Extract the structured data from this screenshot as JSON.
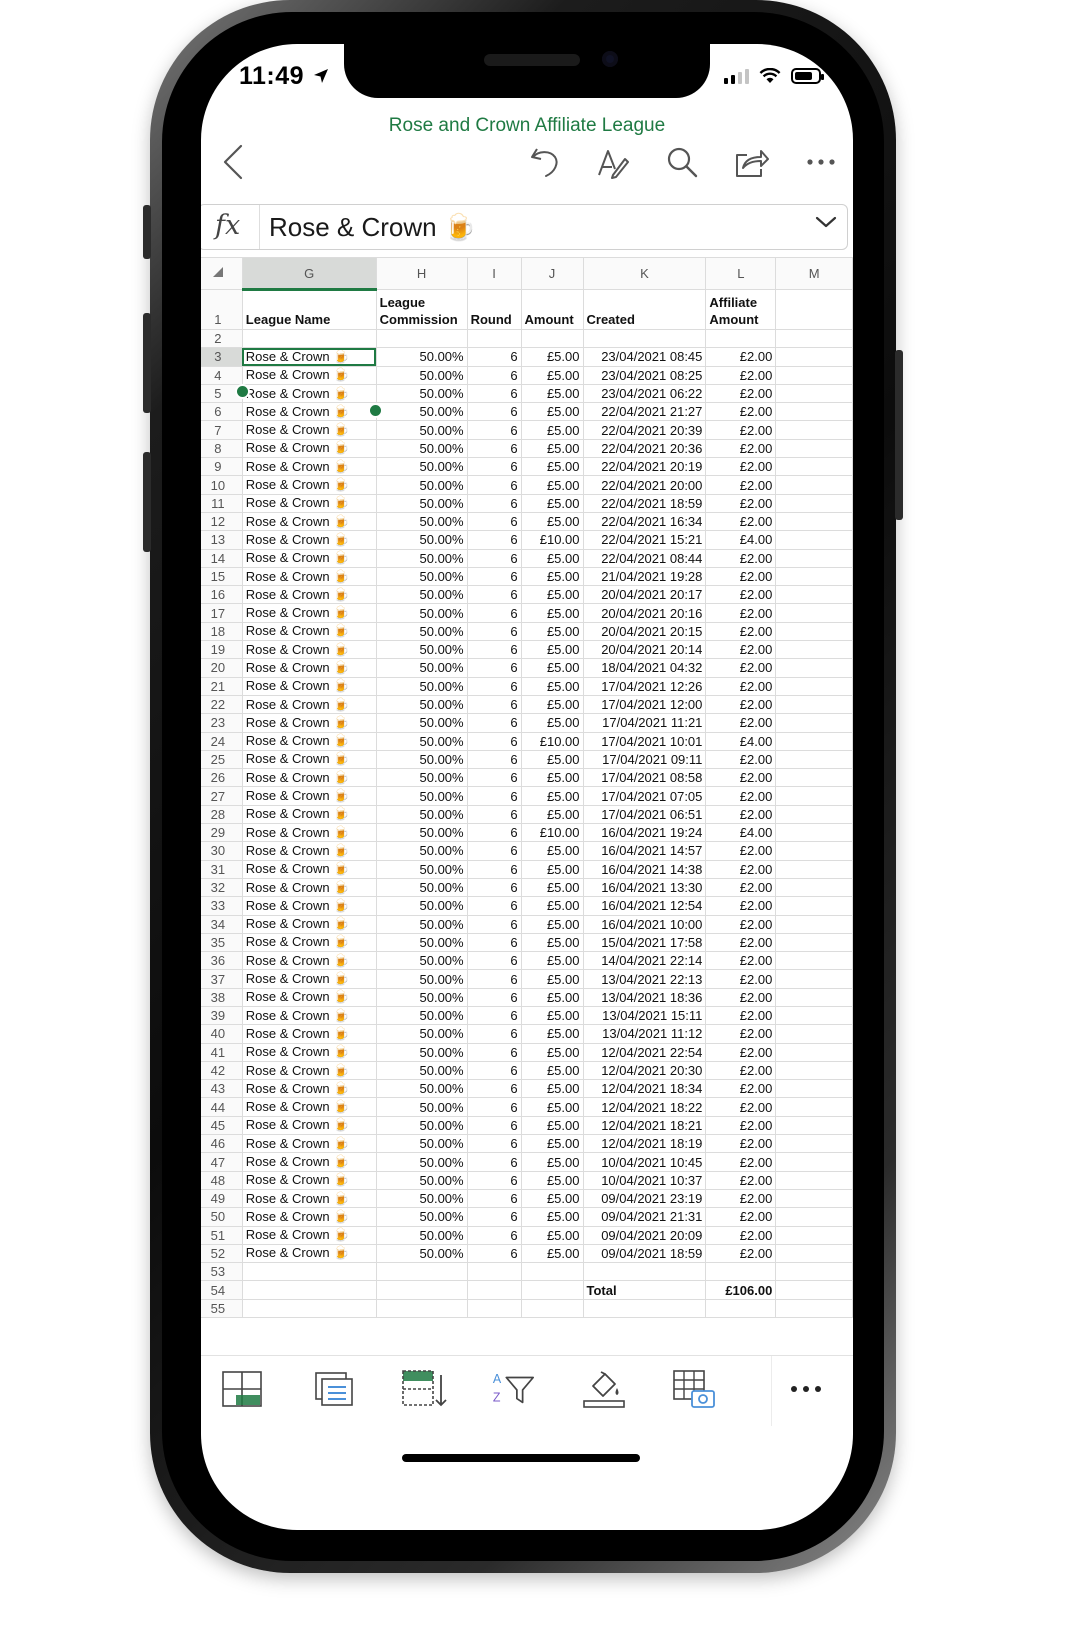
{
  "status": {
    "time": "11:49"
  },
  "document": {
    "title": "Rose and Crown Affiliate League"
  },
  "toolbar": {
    "icons": [
      "back-icon",
      "undo-icon",
      "pen-icon",
      "search-icon",
      "share-icon",
      "more-icon"
    ]
  },
  "formula_bar": {
    "label": "fx",
    "value": "Rose & Crown 🍺"
  },
  "columns": [
    "G",
    "H",
    "I",
    "J",
    "K",
    "L",
    "M"
  ],
  "selected_column": "G",
  "selected_row": 3,
  "header_row": {
    "row_number": "1",
    "cells": [
      "League Name",
      "League\nCommission",
      "Round",
      "Amount",
      "Created",
      "Affiliate\nAmount",
      ""
    ]
  },
  "rows": [
    {
      "n": "3",
      "name": "Rose & Crown 🍺",
      "comm": "50.00%",
      "round": "6",
      "amount": "£5.00",
      "created": "23/04/2021 08:45",
      "aff": "£2.00"
    },
    {
      "n": "4",
      "name": "Rose & Crown 🍺",
      "comm": "50.00%",
      "round": "6",
      "amount": "£5.00",
      "created": "23/04/2021 08:25",
      "aff": "£2.00"
    },
    {
      "n": "5",
      "name": "Rose & Crown 🍺",
      "comm": "50.00%",
      "round": "6",
      "amount": "£5.00",
      "created": "23/04/2021 06:22",
      "aff": "£2.00"
    },
    {
      "n": "6",
      "name": "Rose & Crown 🍺",
      "comm": "50.00%",
      "round": "6",
      "amount": "£5.00",
      "created": "22/04/2021 21:27",
      "aff": "£2.00"
    },
    {
      "n": "7",
      "name": "Rose & Crown 🍺",
      "comm": "50.00%",
      "round": "6",
      "amount": "£5.00",
      "created": "22/04/2021 20:39",
      "aff": "£2.00"
    },
    {
      "n": "8",
      "name": "Rose & Crown 🍺",
      "comm": "50.00%",
      "round": "6",
      "amount": "£5.00",
      "created": "22/04/2021 20:36",
      "aff": "£2.00"
    },
    {
      "n": "9",
      "name": "Rose & Crown 🍺",
      "comm": "50.00%",
      "round": "6",
      "amount": "£5.00",
      "created": "22/04/2021 20:19",
      "aff": "£2.00"
    },
    {
      "n": "10",
      "name": "Rose & Crown 🍺",
      "comm": "50.00%",
      "round": "6",
      "amount": "£5.00",
      "created": "22/04/2021 20:00",
      "aff": "£2.00"
    },
    {
      "n": "11",
      "name": "Rose & Crown 🍺",
      "comm": "50.00%",
      "round": "6",
      "amount": "£5.00",
      "created": "22/04/2021 18:59",
      "aff": "£2.00"
    },
    {
      "n": "12",
      "name": "Rose & Crown 🍺",
      "comm": "50.00%",
      "round": "6",
      "amount": "£5.00",
      "created": "22/04/2021 16:34",
      "aff": "£2.00"
    },
    {
      "n": "13",
      "name": "Rose & Crown 🍺",
      "comm": "50.00%",
      "round": "6",
      "amount": "£10.00",
      "created": "22/04/2021 15:21",
      "aff": "£4.00"
    },
    {
      "n": "14",
      "name": "Rose & Crown 🍺",
      "comm": "50.00%",
      "round": "6",
      "amount": "£5.00",
      "created": "22/04/2021 08:44",
      "aff": "£2.00"
    },
    {
      "n": "15",
      "name": "Rose & Crown 🍺",
      "comm": "50.00%",
      "round": "6",
      "amount": "£5.00",
      "created": "21/04/2021 19:28",
      "aff": "£2.00"
    },
    {
      "n": "16",
      "name": "Rose & Crown 🍺",
      "comm": "50.00%",
      "round": "6",
      "amount": "£5.00",
      "created": "20/04/2021 20:17",
      "aff": "£2.00"
    },
    {
      "n": "17",
      "name": "Rose & Crown 🍺",
      "comm": "50.00%",
      "round": "6",
      "amount": "£5.00",
      "created": "20/04/2021 20:16",
      "aff": "£2.00"
    },
    {
      "n": "18",
      "name": "Rose & Crown 🍺",
      "comm": "50.00%",
      "round": "6",
      "amount": "£5.00",
      "created": "20/04/2021 20:15",
      "aff": "£2.00"
    },
    {
      "n": "19",
      "name": "Rose & Crown 🍺",
      "comm": "50.00%",
      "round": "6",
      "amount": "£5.00",
      "created": "20/04/2021 20:14",
      "aff": "£2.00"
    },
    {
      "n": "20",
      "name": "Rose & Crown 🍺",
      "comm": "50.00%",
      "round": "6",
      "amount": "£5.00",
      "created": "18/04/2021 04:32",
      "aff": "£2.00"
    },
    {
      "n": "21",
      "name": "Rose & Crown 🍺",
      "comm": "50.00%",
      "round": "6",
      "amount": "£5.00",
      "created": "17/04/2021 12:26",
      "aff": "£2.00"
    },
    {
      "n": "22",
      "name": "Rose & Crown 🍺",
      "comm": "50.00%",
      "round": "6",
      "amount": "£5.00",
      "created": "17/04/2021 12:00",
      "aff": "£2.00"
    },
    {
      "n": "23",
      "name": "Rose & Crown 🍺",
      "comm": "50.00%",
      "round": "6",
      "amount": "£5.00",
      "created": "17/04/2021 11:21",
      "aff": "£2.00"
    },
    {
      "n": "24",
      "name": "Rose & Crown 🍺",
      "comm": "50.00%",
      "round": "6",
      "amount": "£10.00",
      "created": "17/04/2021 10:01",
      "aff": "£4.00"
    },
    {
      "n": "25",
      "name": "Rose & Crown 🍺",
      "comm": "50.00%",
      "round": "6",
      "amount": "£5.00",
      "created": "17/04/2021 09:11",
      "aff": "£2.00"
    },
    {
      "n": "26",
      "name": "Rose & Crown 🍺",
      "comm": "50.00%",
      "round": "6",
      "amount": "£5.00",
      "created": "17/04/2021 08:58",
      "aff": "£2.00"
    },
    {
      "n": "27",
      "name": "Rose & Crown 🍺",
      "comm": "50.00%",
      "round": "6",
      "amount": "£5.00",
      "created": "17/04/2021 07:05",
      "aff": "£2.00"
    },
    {
      "n": "28",
      "name": "Rose & Crown 🍺",
      "comm": "50.00%",
      "round": "6",
      "amount": "£5.00",
      "created": "17/04/2021 06:51",
      "aff": "£2.00"
    },
    {
      "n": "29",
      "name": "Rose & Crown 🍺",
      "comm": "50.00%",
      "round": "6",
      "amount": "£10.00",
      "created": "16/04/2021 19:24",
      "aff": "£4.00"
    },
    {
      "n": "30",
      "name": "Rose & Crown 🍺",
      "comm": "50.00%",
      "round": "6",
      "amount": "£5.00",
      "created": "16/04/2021 14:57",
      "aff": "£2.00"
    },
    {
      "n": "31",
      "name": "Rose & Crown 🍺",
      "comm": "50.00%",
      "round": "6",
      "amount": "£5.00",
      "created": "16/04/2021 14:38",
      "aff": "£2.00"
    },
    {
      "n": "32",
      "name": "Rose & Crown 🍺",
      "comm": "50.00%",
      "round": "6",
      "amount": "£5.00",
      "created": "16/04/2021 13:30",
      "aff": "£2.00"
    },
    {
      "n": "33",
      "name": "Rose & Crown 🍺",
      "comm": "50.00%",
      "round": "6",
      "amount": "£5.00",
      "created": "16/04/2021 12:54",
      "aff": "£2.00"
    },
    {
      "n": "34",
      "name": "Rose & Crown 🍺",
      "comm": "50.00%",
      "round": "6",
      "amount": "£5.00",
      "created": "16/04/2021 10:00",
      "aff": "£2.00"
    },
    {
      "n": "35",
      "name": "Rose & Crown 🍺",
      "comm": "50.00%",
      "round": "6",
      "amount": "£5.00",
      "created": "15/04/2021 17:58",
      "aff": "£2.00"
    },
    {
      "n": "36",
      "name": "Rose & Crown 🍺",
      "comm": "50.00%",
      "round": "6",
      "amount": "£5.00",
      "created": "14/04/2021 22:14",
      "aff": "£2.00"
    },
    {
      "n": "37",
      "name": "Rose & Crown 🍺",
      "comm": "50.00%",
      "round": "6",
      "amount": "£5.00",
      "created": "13/04/2021 22:13",
      "aff": "£2.00"
    },
    {
      "n": "38",
      "name": "Rose & Crown 🍺",
      "comm": "50.00%",
      "round": "6",
      "amount": "£5.00",
      "created": "13/04/2021 18:36",
      "aff": "£2.00"
    },
    {
      "n": "39",
      "name": "Rose & Crown 🍺",
      "comm": "50.00%",
      "round": "6",
      "amount": "£5.00",
      "created": "13/04/2021 15:11",
      "aff": "£2.00"
    },
    {
      "n": "40",
      "name": "Rose & Crown 🍺",
      "comm": "50.00%",
      "round": "6",
      "amount": "£5.00",
      "created": "13/04/2021 11:12",
      "aff": "£2.00"
    },
    {
      "n": "41",
      "name": "Rose & Crown 🍺",
      "comm": "50.00%",
      "round": "6",
      "amount": "£5.00",
      "created": "12/04/2021 22:54",
      "aff": "£2.00"
    },
    {
      "n": "42",
      "name": "Rose & Crown 🍺",
      "comm": "50.00%",
      "round": "6",
      "amount": "£5.00",
      "created": "12/04/2021 20:30",
      "aff": "£2.00"
    },
    {
      "n": "43",
      "name": "Rose & Crown 🍺",
      "comm": "50.00%",
      "round": "6",
      "amount": "£5.00",
      "created": "12/04/2021 18:34",
      "aff": "£2.00"
    },
    {
      "n": "44",
      "name": "Rose & Crown 🍺",
      "comm": "50.00%",
      "round": "6",
      "amount": "£5.00",
      "created": "12/04/2021 18:22",
      "aff": "£2.00"
    },
    {
      "n": "45",
      "name": "Rose & Crown 🍺",
      "comm": "50.00%",
      "round": "6",
      "amount": "£5.00",
      "created": "12/04/2021 18:21",
      "aff": "£2.00"
    },
    {
      "n": "46",
      "name": "Rose & Crown 🍺",
      "comm": "50.00%",
      "round": "6",
      "amount": "£5.00",
      "created": "12/04/2021 18:19",
      "aff": "£2.00"
    },
    {
      "n": "47",
      "name": "Rose & Crown 🍺",
      "comm": "50.00%",
      "round": "6",
      "amount": "£5.00",
      "created": "10/04/2021 10:45",
      "aff": "£2.00"
    },
    {
      "n": "48",
      "name": "Rose & Crown 🍺",
      "comm": "50.00%",
      "round": "6",
      "amount": "£5.00",
      "created": "10/04/2021 10:37",
      "aff": "£2.00"
    },
    {
      "n": "49",
      "name": "Rose & Crown 🍺",
      "comm": "50.00%",
      "round": "6",
      "amount": "£5.00",
      "created": "09/04/2021 23:19",
      "aff": "£2.00"
    },
    {
      "n": "50",
      "name": "Rose & Crown 🍺",
      "comm": "50.00%",
      "round": "6",
      "amount": "£5.00",
      "created": "09/04/2021 21:31",
      "aff": "£2.00"
    },
    {
      "n": "51",
      "name": "Rose & Crown 🍺",
      "comm": "50.00%",
      "round": "6",
      "amount": "£5.00",
      "created": "09/04/2021 20:09",
      "aff": "£2.00"
    },
    {
      "n": "52",
      "name": "Rose & Crown 🍺",
      "comm": "50.00%",
      "round": "6",
      "amount": "£5.00",
      "created": "09/04/2021 18:59",
      "aff": "£2.00"
    }
  ],
  "empty_rows": [
    "2",
    "53"
  ],
  "total_row": {
    "n": "54",
    "label": "Total",
    "value": "£106.00"
  },
  "partial_row": {
    "n": "55"
  },
  "bottom_toolbar": {
    "icons": [
      "insert-cells-icon",
      "sheets-icon",
      "fill-down-icon",
      "sort-filter-icon",
      "fill-color-icon",
      "table-camera-icon",
      "more-icon"
    ],
    "sort_letters": [
      "A",
      "Z"
    ]
  },
  "colors": {
    "accent": "#1f7a43",
    "gridline": "#dcdcdc",
    "header_bg": "#fafafa",
    "selected_header_bg": "#d8dad8",
    "icon_blue": "#4a90d9"
  }
}
